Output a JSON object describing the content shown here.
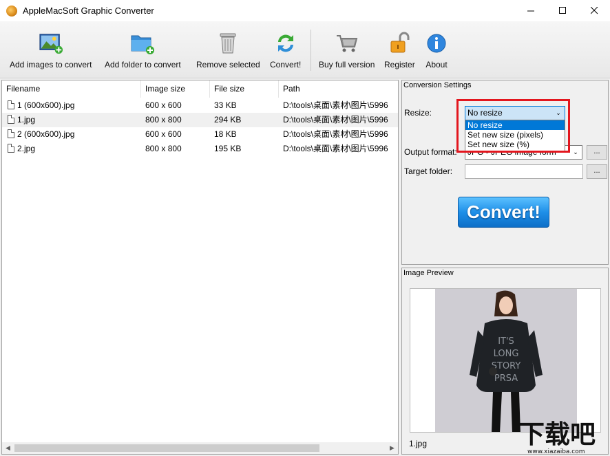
{
  "window": {
    "title": "AppleMacSoft Graphic Converter",
    "controls": {
      "minimize": "—",
      "maximize": "☐",
      "close": "✕"
    }
  },
  "toolbar": {
    "add_images_label": "Add images to convert",
    "add_folder_label": "Add folder to convert",
    "remove_label": "Remove selected",
    "convert_label": "Convert!",
    "buy_label": "Buy full version",
    "register_label": "Register",
    "about_label": "About"
  },
  "filelist": {
    "headers": {
      "filename": "Filename",
      "image_size": "Image size",
      "file_size": "File size",
      "path": "Path"
    },
    "rows": [
      {
        "filename": "1 (600x600).jpg",
        "image_size": "600 x 600",
        "file_size": "33 KB",
        "path": "D:\\tools\\桌面\\素材\\图片\\5996"
      },
      {
        "filename": "1.jpg",
        "image_size": "800 x 800",
        "file_size": "294 KB",
        "path": "D:\\tools\\桌面\\素材\\图片\\5996"
      },
      {
        "filename": "2 (600x600).jpg",
        "image_size": "600 x 600",
        "file_size": "18 KB",
        "path": "D:\\tools\\桌面\\素材\\图片\\5996"
      },
      {
        "filename": "2.jpg",
        "image_size": "800 x 800",
        "file_size": "195 KB",
        "path": "D:\\tools\\桌面\\素材\\图片\\5996"
      }
    ]
  },
  "settings": {
    "title": "Conversion Settings",
    "resize_label": "Resize:",
    "resize_value": "No resize",
    "resize_options": [
      "No resize",
      "Set new size (pixels)",
      "Set new size (%)"
    ],
    "output_format_label": "Output format:",
    "output_format_value": "JPG - JPEG image form",
    "target_folder_label": "Target folder:",
    "target_folder_value": "",
    "browse_label": "...",
    "convert_button": "Convert!"
  },
  "preview": {
    "title": "Image Preview",
    "filename": "1.jpg"
  },
  "watermark": {
    "text": "下载吧",
    "url": "www.xiazaiba.com"
  },
  "colors": {
    "accent": "#0078d7",
    "highlight_box": "#e3161e",
    "convert_blue": "#1e8fe8"
  }
}
